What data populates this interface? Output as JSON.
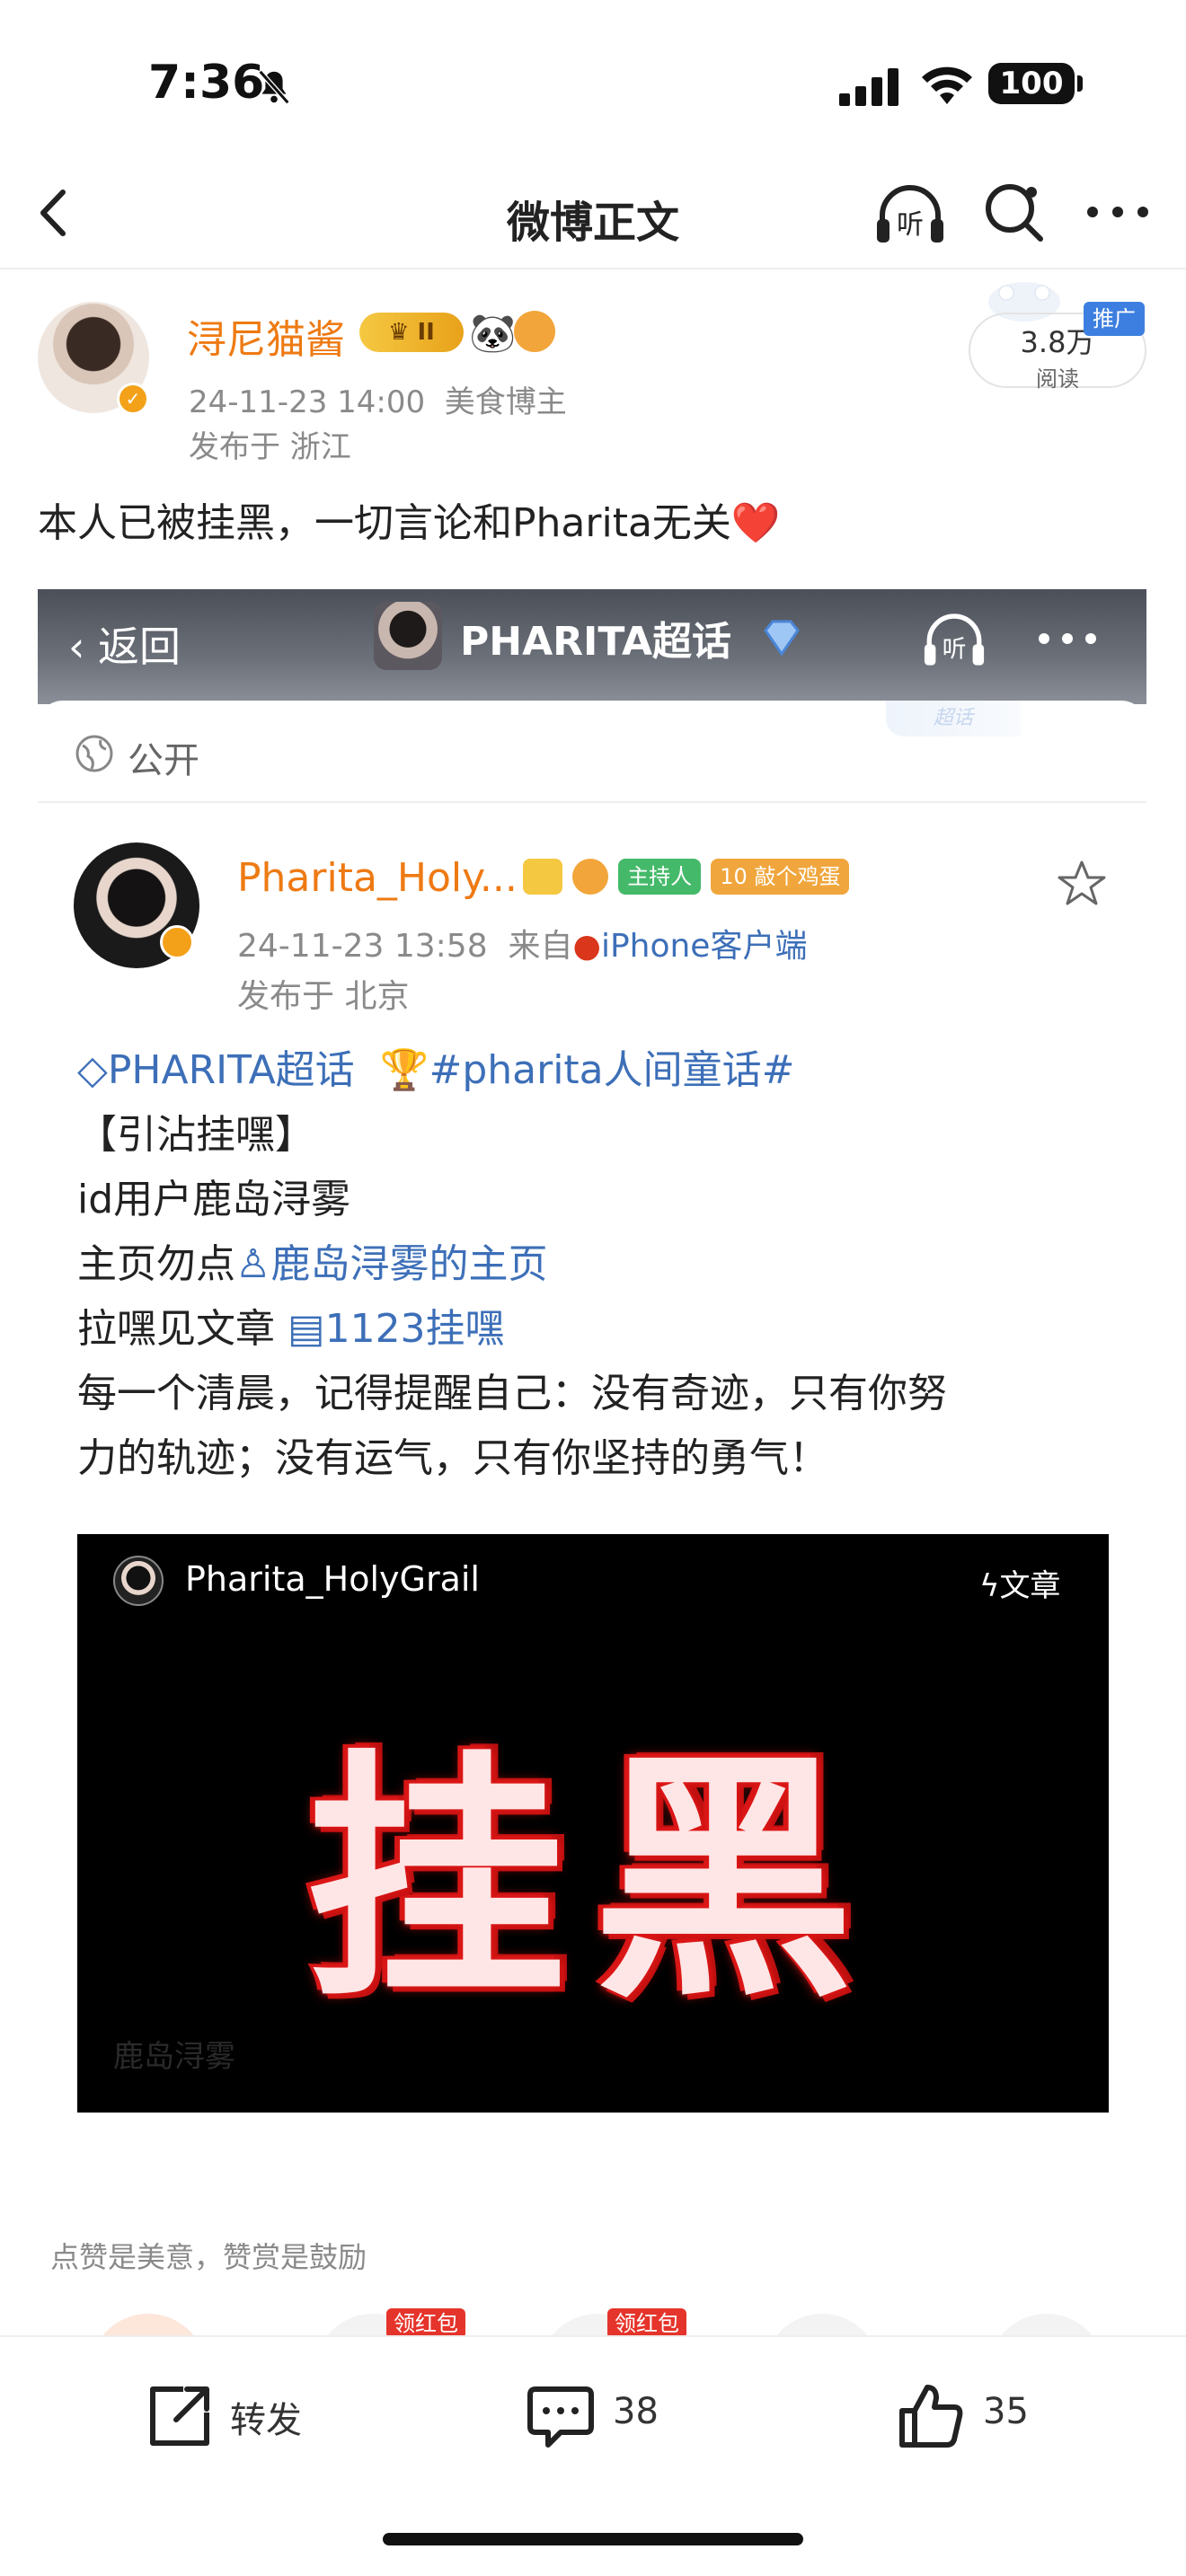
{
  "status_bar": {
    "time": "7:36",
    "battery": "100",
    "icons": [
      "bell-slash-icon",
      "signal-icon",
      "wifi-icon",
      "battery-icon"
    ]
  },
  "nav": {
    "title": "微博正文",
    "icons": [
      "back-chevron-icon",
      "listen-icon",
      "search-icon",
      "more-icon"
    ],
    "listen_label": "听"
  },
  "author": {
    "name": "浔尼猫酱",
    "level_badge": "II",
    "datetime": "24-11-23 14:00",
    "role": "美食博主",
    "location": "发布于 浙江",
    "reads_count": "3.8万",
    "reads_label": "阅读",
    "promo_tag": "推广"
  },
  "post": {
    "text": "本人已被挂黑，一切言论和Pharita无关",
    "emoji": "❤️"
  },
  "embed": {
    "back_label": "返回",
    "topic_title": "PHARITA超话",
    "top_strip": "超话",
    "visibility": "公开",
    "user": {
      "name": "Pharita_Holy...",
      "badge_host": "主持人",
      "badge_egg": "10 敲个鸡蛋",
      "datetime": "24-11-23 13:58",
      "source_prefix": "来自",
      "source": "iPhone客户端",
      "location": "发布于 北京"
    },
    "lines": {
      "topic_link": "PHARITA超话",
      "hashtag": "#pharita人间童话#",
      "l2": "【引沾挂嘿】",
      "l3": "id用户鹿岛浔雾",
      "l4_prefix": "主页勿点",
      "l4_link": "鹿岛浔雾的主页",
      "l5_prefix": "拉嘿见文章",
      "l5_link": "1123挂嘿",
      "l6": "每一个清晨，记得提醒自己：没有奇迹，只有你努",
      "l7": "力的轨迹；没有运气，只有你坚持的勇气！"
    },
    "article": {
      "user": "Pharita_HolyGrail",
      "tag": "文章",
      "big_text": "挂黑",
      "faint_text": "鹿岛浔雾"
    }
  },
  "appreciate_text": "点赞是美意，赞赏是鼓励",
  "redpack_tag": "领红包",
  "toolbar": {
    "repost_label": "转发",
    "comment_count": "38",
    "like_count": "35"
  },
  "colors": {
    "username": "#ee7a13",
    "link": "#3d6fb8",
    "badge_orange": "#f4a11a",
    "heart": "#e0202a"
  }
}
